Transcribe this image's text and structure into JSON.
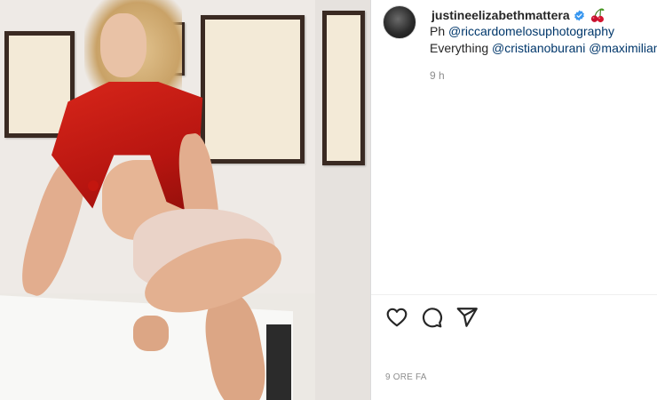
{
  "post": {
    "username": "justineelizabethmattera",
    "badge_icon": "verified-badge-icon",
    "emoji_icon": "cherries-icon",
    "caption": {
      "line1_prefix": "Ph ",
      "line1_mention": "@riccardomelosuphotography",
      "line2_prefix": "Everything ",
      "line2_mention1": "@cristianoburani",
      "line2_mention2": "@maximilian"
    },
    "timestamp": "9 h",
    "posted_ago": "9 ORE FA"
  },
  "actions": {
    "like_icon": "heart-icon",
    "comment_icon": "comment-icon",
    "share_icon": "share-icon"
  },
  "colors": {
    "mention": "#00376b",
    "muted": "#8e8e8e",
    "verified": "#3897f0",
    "text": "#262626"
  }
}
